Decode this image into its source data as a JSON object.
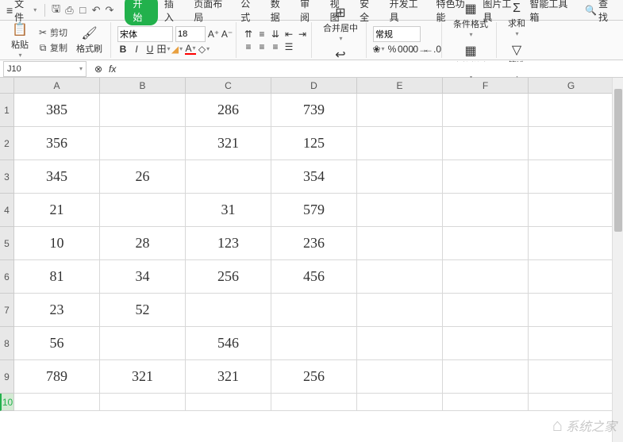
{
  "menubar": {
    "file": "文件",
    "tabs": [
      "开始",
      "插入",
      "页面布局",
      "公式",
      "数据",
      "审阅",
      "视图",
      "安全",
      "开发工具",
      "特色功能",
      "图片工具",
      "智能工具箱"
    ],
    "active_tab_index": 0,
    "search": "查找"
  },
  "ribbon": {
    "paste": "粘贴",
    "cut": "剪切",
    "copy": "复制",
    "format_painter": "格式刷",
    "font_name": "宋体",
    "font_size": "18",
    "merge": "合并居中",
    "wrap": "自动换行",
    "number_format": "常规",
    "cond_format": "条件格式",
    "table_style": "表格样式",
    "sum": "求和",
    "filter": "筛选"
  },
  "formula_bar": {
    "name_box": "J10",
    "fx": "fx",
    "formula": ""
  },
  "sheet": {
    "columns": [
      "A",
      "B",
      "C",
      "D",
      "E",
      "F",
      "G"
    ],
    "row_numbers": [
      "1",
      "2",
      "3",
      "4",
      "5",
      "6",
      "7",
      "8",
      "9",
      "10"
    ],
    "selected_row": 10,
    "data": [
      [
        "385",
        "",
        "286",
        "739",
        "",
        "",
        ""
      ],
      [
        "356",
        "",
        "321",
        "125",
        "",
        "",
        ""
      ],
      [
        "345",
        "26",
        "",
        "354",
        "",
        "",
        ""
      ],
      [
        "21",
        "",
        "31",
        "579",
        "",
        "",
        ""
      ],
      [
        "10",
        "28",
        "123",
        "236",
        "",
        "",
        ""
      ],
      [
        "81",
        "34",
        "256",
        "456",
        "",
        "",
        ""
      ],
      [
        "23",
        "52",
        "",
        "",
        "",
        "",
        ""
      ],
      [
        "56",
        "",
        "546",
        "",
        "",
        "",
        ""
      ],
      [
        "789",
        "321",
        "321",
        "256",
        "",
        "",
        ""
      ],
      [
        "",
        "",
        "",
        "",
        "",
        "",
        ""
      ]
    ]
  },
  "watermark": "系统之家"
}
